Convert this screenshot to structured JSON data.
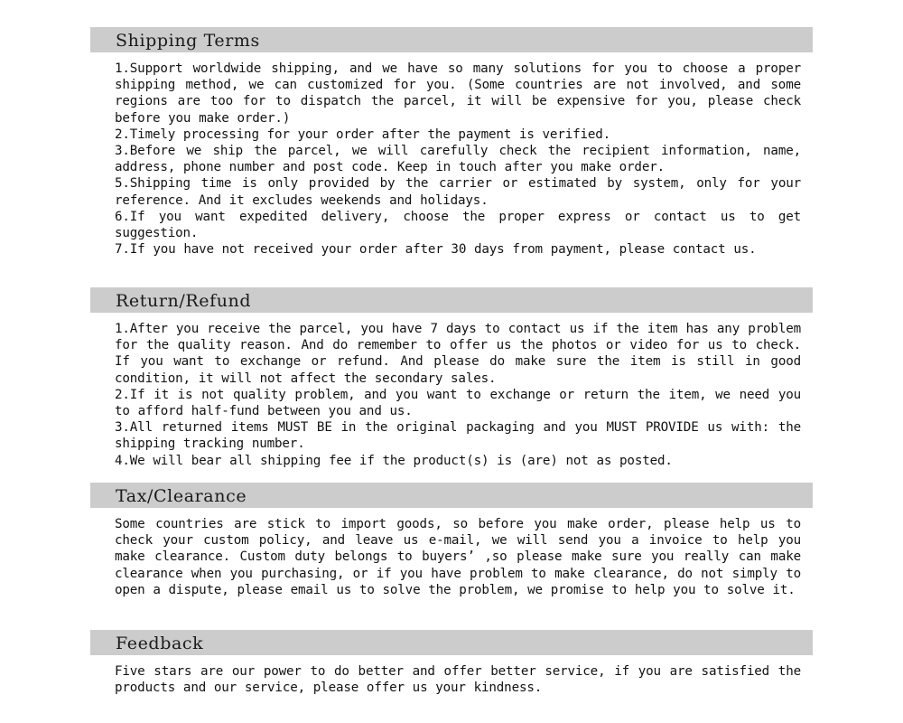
{
  "page": {
    "background_color": "#ffffff",
    "text_color": "#121212",
    "header_background_color": "#cccccc"
  },
  "sections": [
    {
      "id": "shipping-terms",
      "title": "Shipping Terms",
      "paragraphs": [
        "1.Support worldwide shipping, and we have so many solutions for you to choose a proper shipping method, we can customized for you. (Some countries are not involved, and some regions are too for to dispatch the parcel, it will be expensive for you, please check before you make order.)",
        "2.Timely processing for your order after the payment is verified.",
        "3.Before we ship the parcel, we will carefully check the recipient information, name, address, phone number and post code. Keep in touch after you make order.",
        "5.Shipping time is only provided by the carrier or estimated by system, only for your reference. And it excludes weekends and holidays.",
        "6.If you want expedited delivery, choose the proper express or contact us to get suggestion.",
        "7.If you have not received your order after 30 days from payment, please contact us."
      ]
    },
    {
      "id": "return-refund",
      "title": "Return/Refund",
      "paragraphs": [
        "1.After you receive the parcel, you have 7 days to contact us if the item has any problem for the quality reason. And do remember to offer us the photos or video for us to check. If you want to exchange or refund. And please do make sure the item is still in good condition, it will not affect the secondary sales.",
        "2.If it is not quality problem, and you want to exchange or return the item, we need you to afford half-fund between you and us.",
        "3.All returned items MUST BE in the original packaging and you MUST PROVIDE us with: the shipping tracking number.",
        "4.We will bear all shipping fee if the product(s) is (are) not as posted."
      ]
    },
    {
      "id": "tax-clearance",
      "title": "Tax/Clearance",
      "paragraphs": [
        "Some countries are stick to import goods, so before you make order, please help us to check your custom policy, and leave us e-mail, we will send you a invoice to help you make clearance. Custom duty belongs to buyers’ ,so please make sure you really can make clearance when you purchasing, or if you have problem to make clearance, do not simply to open a dispute, please email us to solve the problem, we promise to help you to solve it."
      ]
    },
    {
      "id": "feedback",
      "title": "Feedback",
      "paragraphs": [
        "Five stars are our power to do better and offer better service, if you are satisfied the products and our service, please offer us your kindness."
      ]
    }
  ]
}
